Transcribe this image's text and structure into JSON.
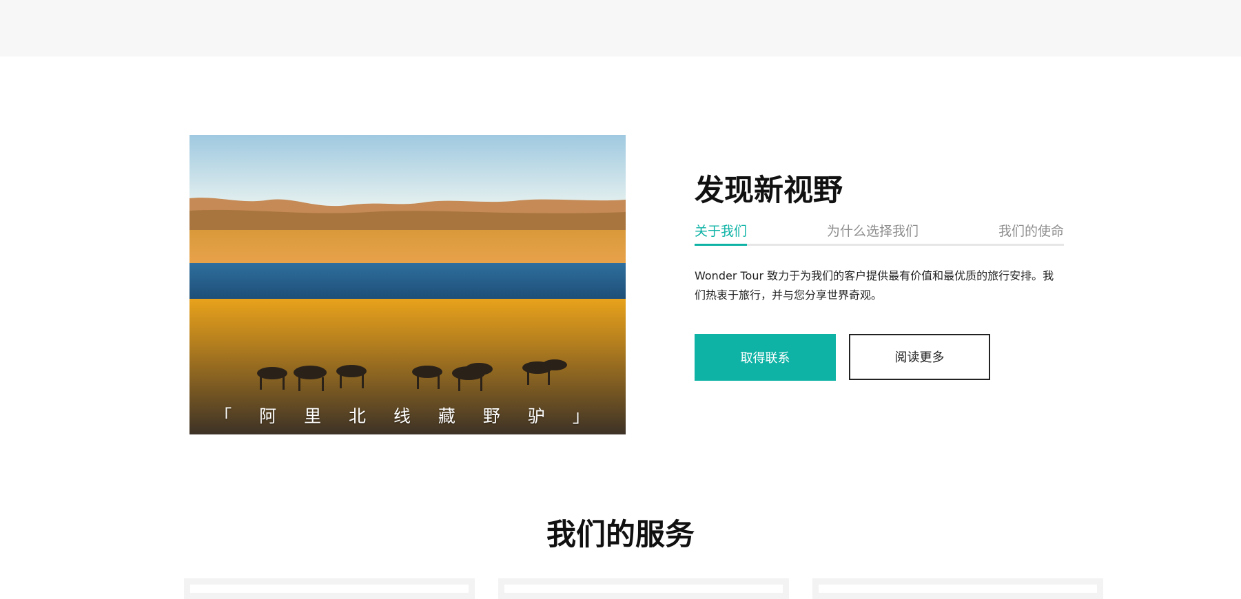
{
  "hero": {
    "caption": "「 阿 里 北 线 藏 野 驴 」"
  },
  "about": {
    "title": "发现新视野",
    "tabs": [
      {
        "label": "关于我们",
        "active": true
      },
      {
        "label": "为什么选择我们",
        "active": false
      },
      {
        "label": "我们的使命",
        "active": false
      }
    ],
    "description": "Wonder Tour 致力于为我们的客户提供最有价值和最优质的旅行安排。我们热衷于旅行，并与您分享世界奇观。",
    "primary_button": "取得联系",
    "secondary_button": "阅读更多"
  },
  "services": {
    "title": "我们的服务"
  },
  "colors": {
    "accent": "#0fb3a6",
    "top_band": "#f7f7f7",
    "heading": "#111111",
    "muted_tab": "#8f8f8f"
  }
}
